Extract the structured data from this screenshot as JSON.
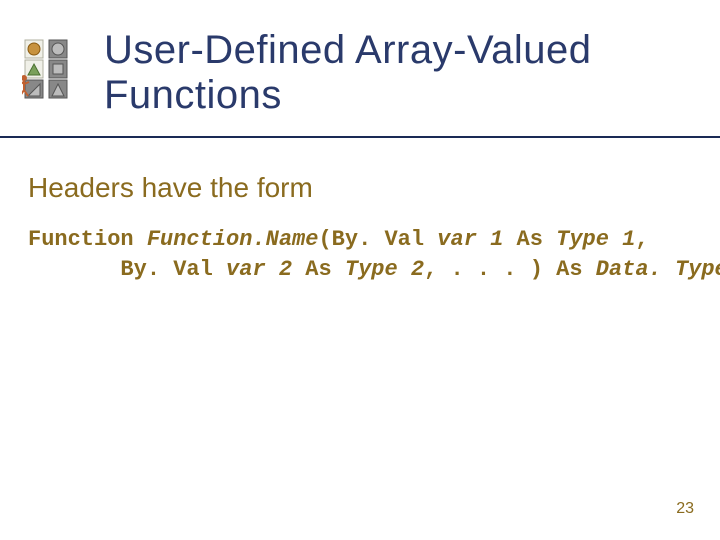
{
  "title_line1": "User-Defined Array-Valued",
  "title_line2": "Functions",
  "intro": "Headers have the form",
  "code": {
    "kw_function": "Function",
    "name": "Function.Name",
    "open": "(",
    "byval1": "By. Val ",
    "var1": "var 1",
    "as1": " As ",
    "type1": "Type 1",
    "comma1": ",",
    "indent": "       ",
    "byval2": "By. Val ",
    "var2": "var 2",
    "as2": " As ",
    "type2": "Type 2",
    "ellipsis": ", . . . ) As ",
    "datatype": "Data. Type",
    "close": "()"
  },
  "page_number": "23"
}
